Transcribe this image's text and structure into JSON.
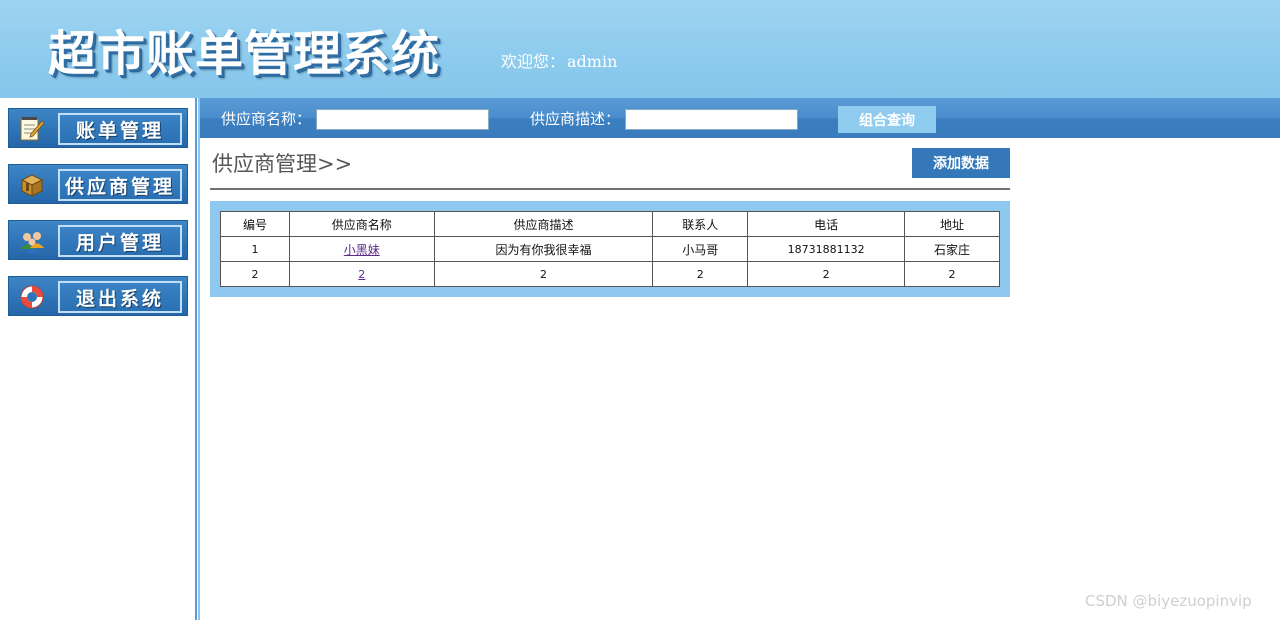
{
  "header": {
    "title": "超市账单管理系统",
    "welcome_label": "欢迎您：",
    "username": "admin"
  },
  "sidebar": {
    "items": [
      {
        "label": "账单管理",
        "icon": "notepad-pencil-icon"
      },
      {
        "label": "供应商管理",
        "icon": "box-icon"
      },
      {
        "label": "用户管理",
        "icon": "users-icon"
      },
      {
        "label": "退出系统",
        "icon": "lifebuoy-icon"
      }
    ]
  },
  "search": {
    "name_label": "供应商名称：",
    "name_value": "",
    "desc_label": "供应商描述：",
    "desc_value": "",
    "button_label": "组合查询"
  },
  "content": {
    "title": "供应商管理>>",
    "add_button": "添加数据"
  },
  "table": {
    "headers": [
      "编号",
      "供应商名称",
      "供应商描述",
      "联系人",
      "电话",
      "地址"
    ],
    "rows": [
      [
        "1",
        "小黑妹",
        "因为有你我很幸福",
        "小马哥",
        "18731881132",
        "石家庄"
      ],
      [
        "2",
        "2",
        "2",
        "2",
        "2",
        "2"
      ]
    ]
  },
  "watermark": "CSDN @biyezuopinvip",
  "colors": {
    "header_bg": "#8ccbee",
    "nav_blue": "#2e74b7",
    "search_bar": "#4a8dcc",
    "table_frame": "#8ec8ef",
    "link": "#5b2c8a"
  }
}
